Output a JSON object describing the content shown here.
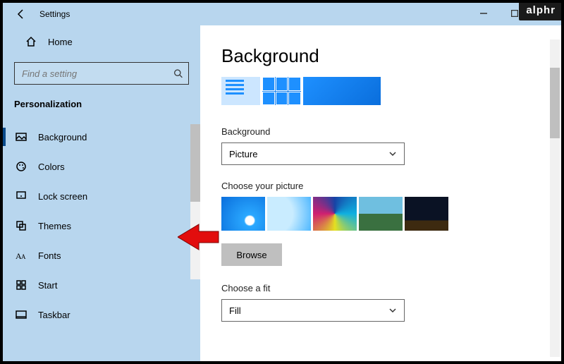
{
  "window": {
    "title": "Settings"
  },
  "sidebar": {
    "home_label": "Home",
    "search_placeholder": "Find a setting",
    "section_title": "Personalization",
    "items": [
      {
        "label": "Background",
        "active": true
      },
      {
        "label": "Colors"
      },
      {
        "label": "Lock screen"
      },
      {
        "label": "Themes"
      },
      {
        "label": "Fonts"
      },
      {
        "label": "Start"
      },
      {
        "label": "Taskbar"
      }
    ]
  },
  "main": {
    "heading": "Background",
    "bg_label": "Background",
    "bg_value": "Picture",
    "choose_picture_label": "Choose your picture",
    "browse_label": "Browse",
    "fit_label": "Choose a fit",
    "fit_value": "Fill"
  },
  "badge": "alphr"
}
